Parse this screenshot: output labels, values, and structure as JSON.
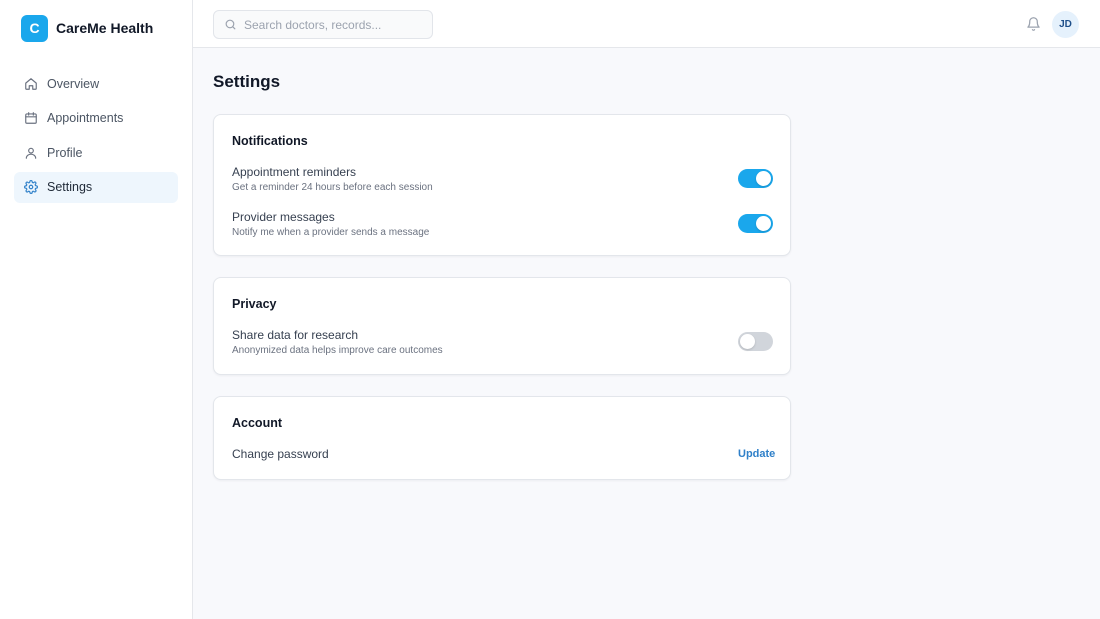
{
  "brand": {
    "logo_letter": "C",
    "name": "CareMe Health"
  },
  "sidebar": {
    "items": [
      {
        "label": "Overview",
        "icon": "home-icon",
        "active": false
      },
      {
        "label": "Appointments",
        "icon": "calendar-icon",
        "active": false
      },
      {
        "label": "Profile",
        "icon": "user-icon",
        "active": false
      },
      {
        "label": "Settings",
        "icon": "gear-icon",
        "active": true
      }
    ]
  },
  "topbar": {
    "search": {
      "placeholder": "Search doctors, records...",
      "value": ""
    },
    "notifications_icon": "bell-icon",
    "avatar_initials": "JD"
  },
  "page": {
    "title": "Settings"
  },
  "sections": {
    "notifications": {
      "title": "Notifications",
      "settings": [
        {
          "label": "Appointment reminders",
          "description": "Get a reminder 24 hours before each session",
          "enabled": true
        },
        {
          "label": "Provider messages",
          "description": "Notify me when a provider sends a message",
          "enabled": true
        }
      ]
    },
    "privacy": {
      "title": "Privacy",
      "settings": [
        {
          "label": "Share data for research",
          "description": "Anonymized data helps improve care outcomes",
          "enabled": false
        }
      ]
    },
    "account": {
      "title": "Account",
      "settings": [
        {
          "label": "Change password",
          "action": "Update"
        }
      ]
    }
  },
  "colors": {
    "accent": "#1aa7ec",
    "toggle_off": "#d1d5db",
    "link": "#2f80c9",
    "active_nav_bg": "#eef6fd"
  }
}
